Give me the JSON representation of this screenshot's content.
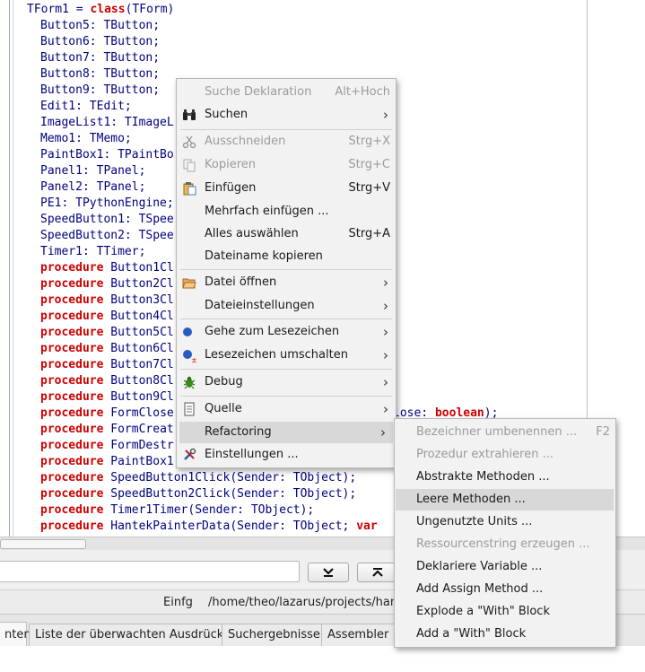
{
  "editor": {
    "code_lines": [
      {
        "pre": "TForm1 = ",
        "kw": "class",
        "post": "(TForm)",
        "indent": false
      },
      {
        "pre": "Button5: TButton;",
        "indent": true
      },
      {
        "pre": "Button6: TButton;",
        "indent": true
      },
      {
        "pre": "Button7: TButton;",
        "indent": true
      },
      {
        "pre": "Button8: TButton;",
        "indent": true
      },
      {
        "pre": "Button9: TButton;",
        "indent": true
      },
      {
        "pre": "Edit1: TEdit;",
        "indent": true
      },
      {
        "pre": "ImageList1: TImageL",
        "indent": true
      },
      {
        "pre": "Memo1: TMemo;",
        "indent": true
      },
      {
        "pre": "PaintBox1: TPaintBo",
        "indent": true
      },
      {
        "pre": "Panel1: TPanel;",
        "indent": true
      },
      {
        "pre": "Panel2: TPanel;",
        "indent": true
      },
      {
        "pre": "PE1: TPythonEngine;",
        "indent": true
      },
      {
        "pre": "SpeedButton1: TSpee",
        "indent": true
      },
      {
        "pre": "SpeedButton2: TSpee",
        "indent": true
      },
      {
        "pre": "Timer1: TTimer;",
        "indent": true
      },
      {
        "kw": "procedure",
        "post": " Button1Cl",
        "indent": true
      },
      {
        "kw": "procedure",
        "post": " Button2Cl",
        "indent": true
      },
      {
        "kw": "procedure",
        "post": " Button3Cl",
        "indent": true
      },
      {
        "kw": "procedure",
        "post": " Button4Cl",
        "indent": true
      },
      {
        "kw": "procedure",
        "post": " Button5Cl",
        "indent": true
      },
      {
        "kw": "procedure",
        "post": " Button6Cl",
        "indent": true
      },
      {
        "kw": "procedure",
        "post": " Button7Cl",
        "indent": true
      },
      {
        "kw": "procedure",
        "post": " Button8Cl",
        "indent": true
      },
      {
        "kw": "procedure",
        "post": " Button9Cl",
        "indent": true
      },
      {
        "kw": "procedure",
        "post": " FormClose",
        "tail": "lose: ",
        "tailkw": "boolean",
        "tailend": ");",
        "indent": true
      },
      {
        "kw": "procedure",
        "post": " FormCreat",
        "indent": true
      },
      {
        "kw": "procedure",
        "post": " FormDestr",
        "indent": true
      },
      {
        "kw": "procedure",
        "post": " PaintBox1",
        "indent": true
      },
      {
        "kw": "procedure",
        "post": " SpeedButton1Click(Sender: TObject);",
        "indent": true
      },
      {
        "kw": "procedure",
        "post": " SpeedButton2Click(Sender: TObject);",
        "indent": true
      },
      {
        "kw": "procedure",
        "post": " Timer1Timer(Sender: TObject);",
        "indent": true
      },
      {
        "kw": "procedure",
        "post": " HantekPainterData(Sender: TObject; ",
        "kw2": "var",
        "indent": true
      }
    ]
  },
  "findbar": {
    "down_icon": "arrow-down-to-bar",
    "up_icon": "arrow-up-to-bar"
  },
  "statusbar": {
    "mode": "Einfg",
    "path": "/home/theo/lazarus/projects/hant"
  },
  "tabs": [
    {
      "label": "nten"
    },
    {
      "label": "Liste der überwachten Ausdrücke"
    },
    {
      "label": "Suchergebnisse"
    },
    {
      "label": "Assembler"
    }
  ],
  "context_menu": {
    "items": [
      {
        "label": "Suche Deklaration",
        "shortcut": "Alt+Hoch",
        "disabled": true,
        "icon": ""
      },
      {
        "label": "Suchen",
        "submenu": true,
        "icon": "binoculars-icon"
      },
      {
        "label": "Ausschneiden",
        "shortcut": "Strg+X",
        "disabled": true,
        "icon": "scissors-icon"
      },
      {
        "label": "Kopieren",
        "shortcut": "Strg+C",
        "disabled": true,
        "icon": "copy-icon"
      },
      {
        "label": "Einfügen",
        "shortcut": "Strg+V",
        "icon": "paste-icon"
      },
      {
        "label": "Mehrfach einfügen ...",
        "icon": ""
      },
      {
        "label": "Alles auswählen",
        "shortcut": "Strg+A",
        "icon": ""
      },
      {
        "label": "Dateiname kopieren",
        "icon": ""
      },
      {
        "label": "Datei öffnen",
        "submenu": true,
        "icon": "folder-open-icon"
      },
      {
        "label": "Dateieinstellungen",
        "submenu": true,
        "icon": ""
      },
      {
        "label": "Gehe zum Lesezeichen",
        "submenu": true,
        "icon": "bookmark-icon"
      },
      {
        "label": "Lesezeichen umschalten",
        "submenu": true,
        "icon": "bookmark-toggle-icon"
      },
      {
        "label": "Debug",
        "submenu": true,
        "icon": "bug-icon"
      },
      {
        "label": "Quelle",
        "submenu": true,
        "icon": "source-file-icon"
      },
      {
        "label": "Refactoring",
        "submenu": true,
        "icon": "",
        "highlighted": true
      },
      {
        "label": "Einstellungen ...",
        "icon": "tools-icon"
      }
    ]
  },
  "refactoring_menu": {
    "items": [
      {
        "label": "Bezeichner umbenennen ...",
        "shortcut": "F2",
        "disabled": true
      },
      {
        "label": "Prozedur extrahieren ...",
        "disabled": true
      },
      {
        "label": "Abstrakte Methoden ..."
      },
      {
        "label": "Leere Methoden ...",
        "highlighted": true
      },
      {
        "label": "Ungenutzte Units ..."
      },
      {
        "label": "Ressourcenstring erzeugen ...",
        "disabled": true
      },
      {
        "label": "Deklariere Variable ..."
      },
      {
        "label": "Add Assign Method ..."
      },
      {
        "label": "Explode a \"With\" Block"
      },
      {
        "label": "Add a \"With\" Block"
      }
    ]
  }
}
